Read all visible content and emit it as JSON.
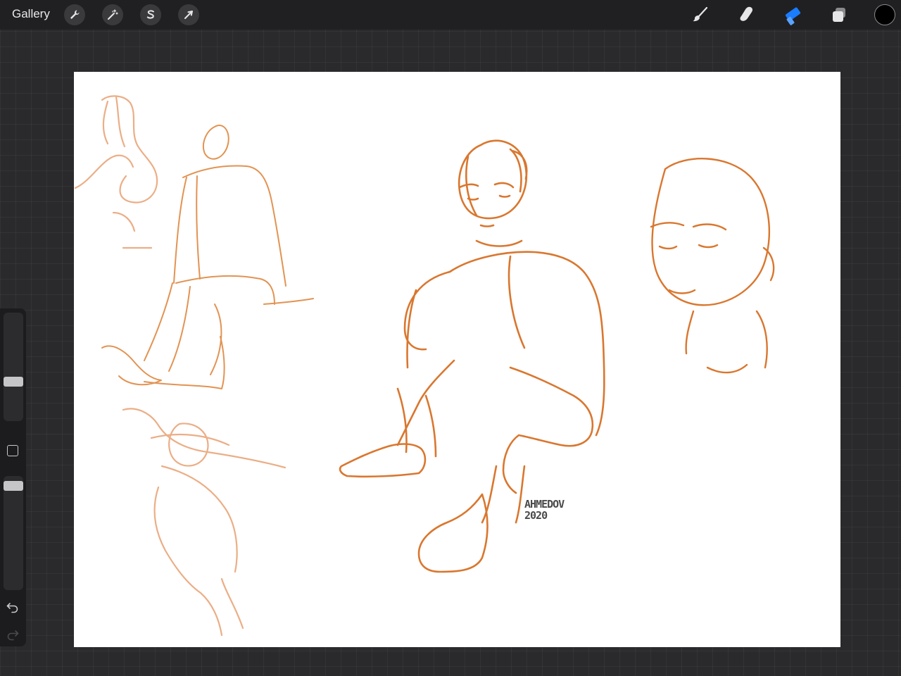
{
  "app": "Procreate",
  "topbar": {
    "gallery_label": "Gallery",
    "left_tools": [
      {
        "name": "actions",
        "icon": "wrench-icon"
      },
      {
        "name": "adjustments",
        "icon": "magic-wand-icon"
      },
      {
        "name": "selection",
        "icon": "selection-s-icon"
      },
      {
        "name": "transform",
        "icon": "arrow-cursor-icon"
      }
    ],
    "right_tools": [
      {
        "name": "brush",
        "icon": "brush-icon",
        "active": false
      },
      {
        "name": "smudge",
        "icon": "smudge-finger-icon",
        "active": false
      },
      {
        "name": "eraser",
        "icon": "eraser-icon",
        "active": true
      },
      {
        "name": "layers",
        "icon": "layers-icon",
        "active": false
      }
    ],
    "current_color": "#000000",
    "accent_color": "#1a7cff"
  },
  "sidebar": {
    "brush_size": 0.35,
    "opacity": 0.95,
    "undo_icon": "undo-icon",
    "redo_icon": "redo-icon"
  },
  "canvas": {
    "background": "#ffffff",
    "stroke_color": "#d9772f",
    "signature": {
      "name": "AHMEDOV",
      "year": "2020"
    }
  }
}
